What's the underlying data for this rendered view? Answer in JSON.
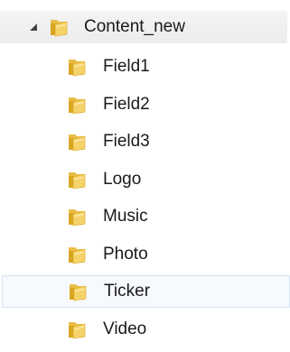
{
  "tree": {
    "root": {
      "label": "Content_new",
      "icon": "folder-open-icon",
      "expanded": true
    },
    "children": [
      {
        "label": "Field1",
        "icon": "folder-icon"
      },
      {
        "label": "Field2",
        "icon": "folder-icon"
      },
      {
        "label": "Field3",
        "icon": "folder-icon"
      },
      {
        "label": "Logo",
        "icon": "folder-icon"
      },
      {
        "label": "Music",
        "icon": "folder-icon"
      },
      {
        "label": "Photo",
        "icon": "folder-icon"
      },
      {
        "label": "Ticker",
        "icon": "folder-icon",
        "selected": true
      },
      {
        "label": "Video",
        "icon": "folder-icon"
      }
    ]
  },
  "colors": {
    "folder_back": "#d9a622",
    "folder_front": "#f5d36a",
    "selection_background": "#f6f9fd",
    "selection_border": "#d6e3f2",
    "text": "#1a1a1a"
  }
}
